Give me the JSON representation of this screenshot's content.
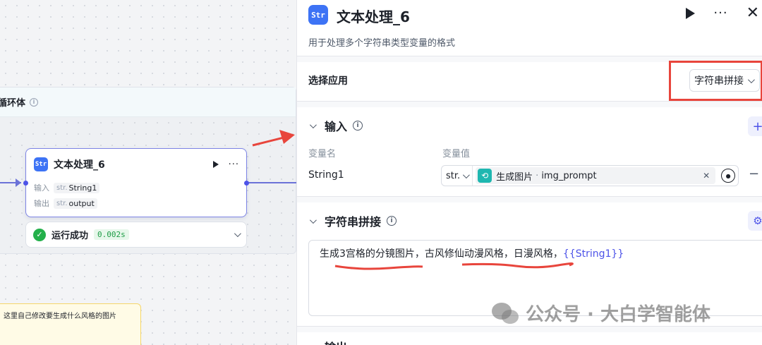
{
  "canvas": {
    "loop_title": "循环体",
    "node": {
      "title": "文本处理_6",
      "input_label": "输入",
      "input_type": "str.",
      "input_value": "String1",
      "output_label": "输出",
      "output_type": "str.",
      "output_value": "output",
      "icon": "text-processing-icon"
    },
    "status": {
      "text": "运行成功",
      "time": "0.002s"
    },
    "note": "这里自己修改要生成什么风格的图片"
  },
  "panel": {
    "title": "文本处理_6",
    "description": "用于处理多个字符串类型变量的格式",
    "app_select": {
      "label": "选择应用",
      "value": "字符串拼接"
    },
    "input": {
      "title": "输入",
      "col_name": "变量名",
      "col_value": "变量值",
      "var_name": "String1",
      "var_type": "str.",
      "ref_source": "生成图片",
      "ref_separator": "·",
      "ref_field": "img_prompt"
    },
    "concat": {
      "title": "字符串拼接",
      "text_part1": "生成3宫格的分镜图片，",
      "text_part2": "古风修仙动漫风格，",
      "text_part3": "日漫风格，",
      "text_var": "{{String1}}"
    },
    "output": {
      "title": "输出"
    }
  },
  "watermark": "公众号 · 大白学智能体",
  "colors": {
    "accent": "#4d53e8",
    "brand_icon": "#3d73f5",
    "success": "#23b04b",
    "highlight": "#e8453c",
    "ref_icon": "#1fb7b0"
  }
}
